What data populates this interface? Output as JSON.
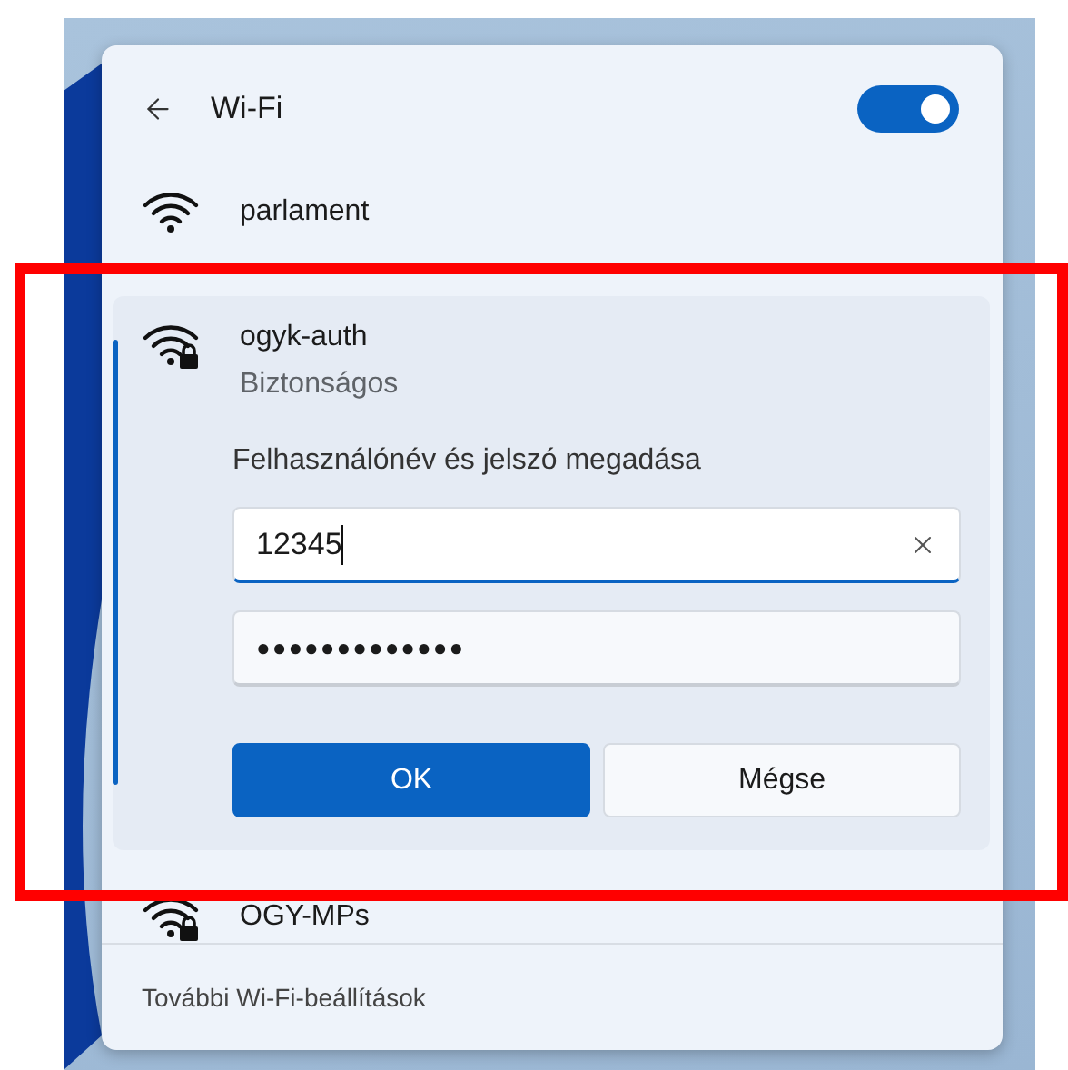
{
  "header": {
    "title": "Wi-Fi",
    "wifi_on": true
  },
  "networks": [
    {
      "name": "parlament",
      "expanded": false,
      "secured": false
    },
    {
      "name": "ogyk-auth",
      "expanded": true,
      "secured": true,
      "status": "Biztonságos",
      "prompt": "Felhasználónév és jelszó megadása",
      "username": "12345",
      "password": "●●●●●●●●●●●●●",
      "buttons": [
        {
          "label": "OK",
          "primary": true
        },
        {
          "label": "Mégse",
          "primary": false
        }
      ]
    },
    {
      "name": "OGY-MPs",
      "expanded": false,
      "secured": true
    }
  ],
  "footer": {
    "link": "További Wi-Fi-beállítások"
  }
}
